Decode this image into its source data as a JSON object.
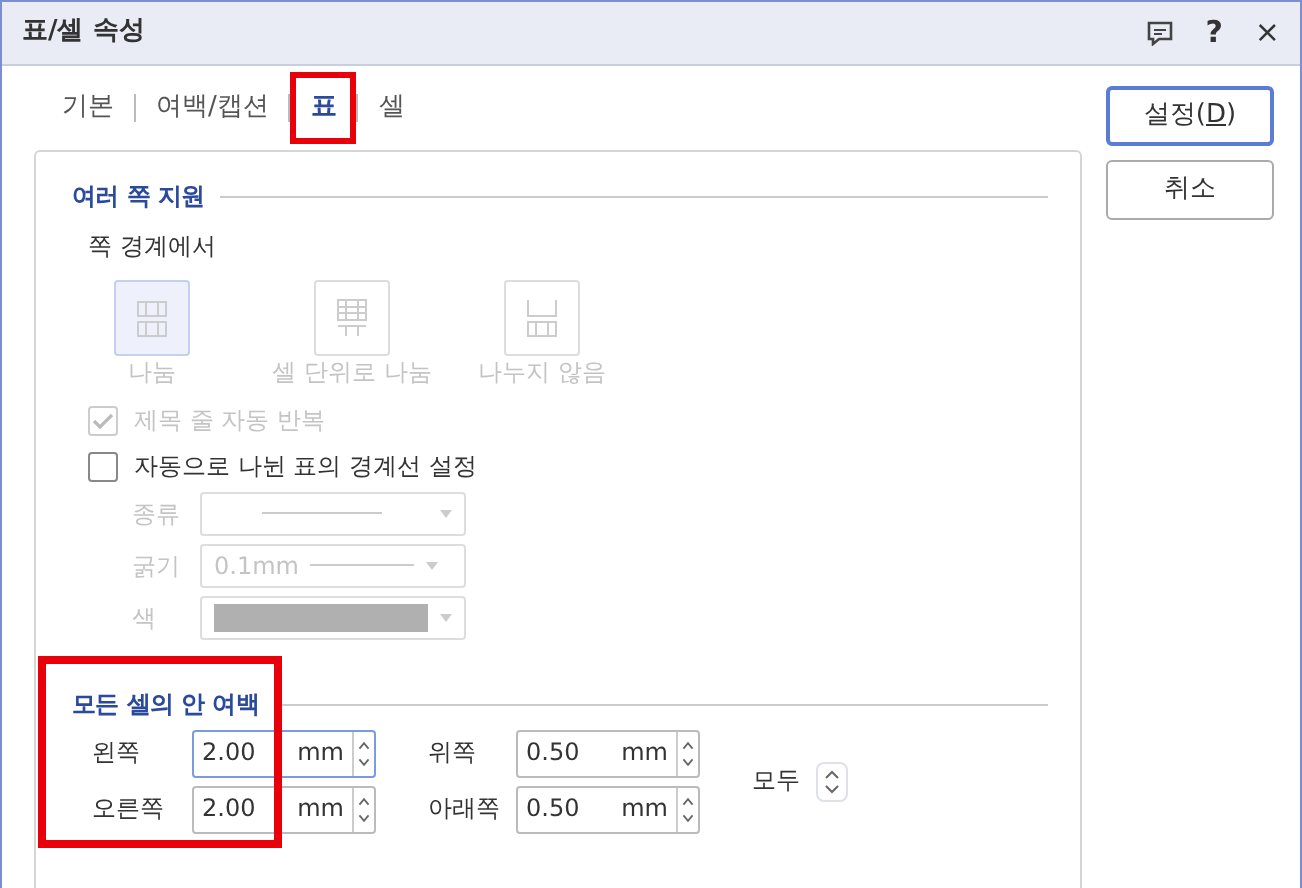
{
  "window": {
    "title": "표/셀 속성",
    "help": "?",
    "close": "×"
  },
  "tabs": [
    {
      "label": "기본",
      "selected": false,
      "highlighted": false
    },
    {
      "label": "여백/캡션",
      "selected": false,
      "highlighted": false
    },
    {
      "label": "표",
      "selected": true,
      "highlighted": true
    },
    {
      "label": "셀",
      "selected": false,
      "highlighted": false
    }
  ],
  "multi_page": {
    "title": "여러 쪽 지원",
    "subtitle": "쪽 경계에서",
    "disabled": true,
    "options": [
      {
        "kind": "split",
        "label": "나눔",
        "selected": true
      },
      {
        "kind": "cells",
        "label": "셀 단위로 나눔",
        "selected": false
      },
      {
        "kind": "none",
        "label": "나누지 않음",
        "selected": false
      }
    ],
    "checkboxes": [
      {
        "label": "제목 줄 자동 반복",
        "checked": true,
        "disabled": true
      },
      {
        "label": "자동으로 나뉜 표의 경계선 설정",
        "checked": false,
        "disabled": false
      }
    ],
    "border_settings": [
      {
        "kind": "line",
        "label": "종류"
      },
      {
        "kind": "thickness",
        "label": "굵기",
        "value": "0.1mm"
      },
      {
        "kind": "color",
        "label": "색",
        "color": "#b0b0b0"
      }
    ]
  },
  "margins": {
    "title": "모든 셀의 안 여백",
    "highlighted": true,
    "all_label": "모두",
    "fields": [
      {
        "label": "왼쪽",
        "value": "2.00",
        "unit": "mm",
        "focused": true
      },
      {
        "label": "위쪽",
        "value": "0.50",
        "unit": "mm",
        "focused": false
      },
      {
        "label": "오른쪽",
        "value": "2.00",
        "unit": "mm",
        "focused": false
      },
      {
        "label": "아래쪽",
        "value": "0.50",
        "unit": "mm",
        "focused": false
      }
    ]
  },
  "buttons": [
    {
      "label_before": "설정(",
      "mnemonic": "D",
      "label_after": ")",
      "default": true
    },
    {
      "label_before": "취소",
      "default": false
    }
  ]
}
